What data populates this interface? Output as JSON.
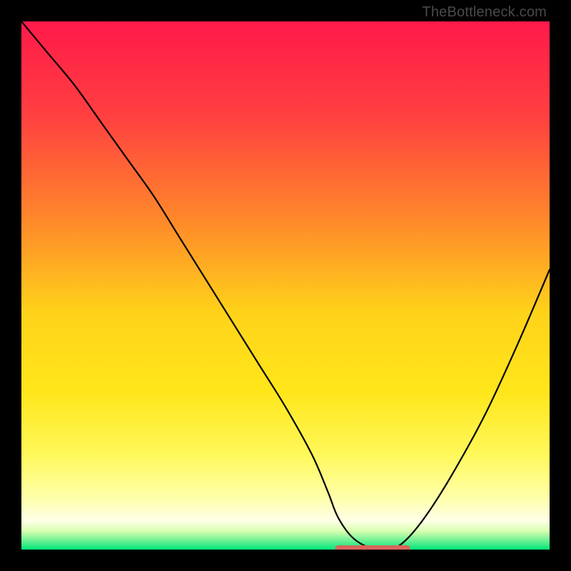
{
  "watermark": "TheBottleneck.com",
  "colors": {
    "frame": "#000000",
    "curve": "#000000",
    "marker": "#d9655b",
    "gradient_stops": [
      {
        "offset": 0.0,
        "color": "#ff1a4a"
      },
      {
        "offset": 0.18,
        "color": "#ff4040"
      },
      {
        "offset": 0.38,
        "color": "#ff8a2a"
      },
      {
        "offset": 0.55,
        "color": "#ffd21a"
      },
      {
        "offset": 0.7,
        "color": "#ffe61a"
      },
      {
        "offset": 0.82,
        "color": "#fff85a"
      },
      {
        "offset": 0.9,
        "color": "#ffffa8"
      },
      {
        "offset": 0.945,
        "color": "#ffffe8"
      },
      {
        "offset": 0.965,
        "color": "#d8ffb0"
      },
      {
        "offset": 0.985,
        "color": "#60ef90"
      },
      {
        "offset": 1.0,
        "color": "#00e57a"
      }
    ]
  },
  "chart_data": {
    "type": "line",
    "title": "",
    "xlabel": "",
    "ylabel": "",
    "xlim": [
      0,
      100
    ],
    "ylim": [
      0,
      100
    ],
    "series": [
      {
        "name": "bottleneck-curve",
        "x": [
          0,
          5,
          10,
          15,
          20,
          25,
          30,
          35,
          40,
          45,
          50,
          55,
          58,
          60,
          63,
          67,
          70,
          73,
          77,
          82,
          88,
          94,
          100
        ],
        "y": [
          100,
          94,
          88,
          81,
          74,
          67,
          59,
          51,
          43,
          35,
          27,
          18,
          11,
          6,
          2,
          0,
          0,
          2,
          7,
          15,
          26,
          39,
          53
        ]
      }
    ],
    "marker_segment": {
      "x_start": 60,
      "x_end": 73,
      "y": 0.2
    }
  }
}
